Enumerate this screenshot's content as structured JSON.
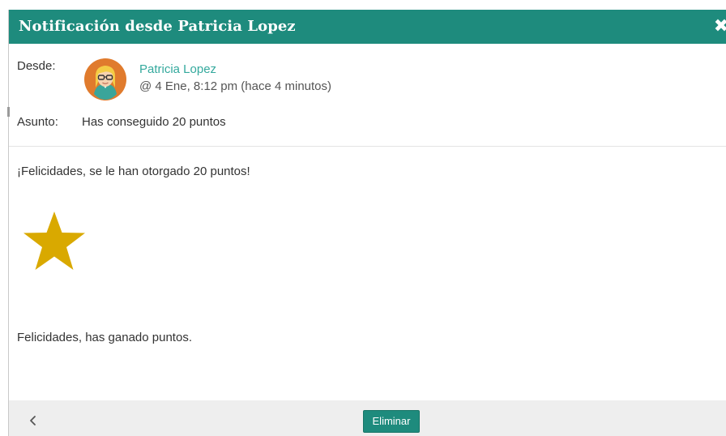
{
  "dialog": {
    "title": "Notificación desde Patricia Lopez",
    "close_glyph": "✖"
  },
  "meta": {
    "from_label": "Desde:",
    "sender_name": "Patricia Lopez",
    "timestamp": "@ 4 Ene, 8:12 pm (hace 4 minutos)",
    "subject_label": "Asunto:",
    "subject": "Has conseguido 20 puntos",
    "avatar_icon": "avatar-woman-blonde-glasses"
  },
  "message": {
    "line1": "¡Felicidades, se le han otorgado 20 puntos!",
    "star_icon": "star-icon",
    "line2": "Felicidades, has ganado puntos."
  },
  "footer": {
    "back_icon": "chevron-left-icon",
    "delete_label": "Eliminar"
  },
  "colors": {
    "header": "#1e8b7d",
    "sender_link": "#34a99d",
    "star": "#d9a900",
    "avatar_bg": "#e07b2d"
  }
}
